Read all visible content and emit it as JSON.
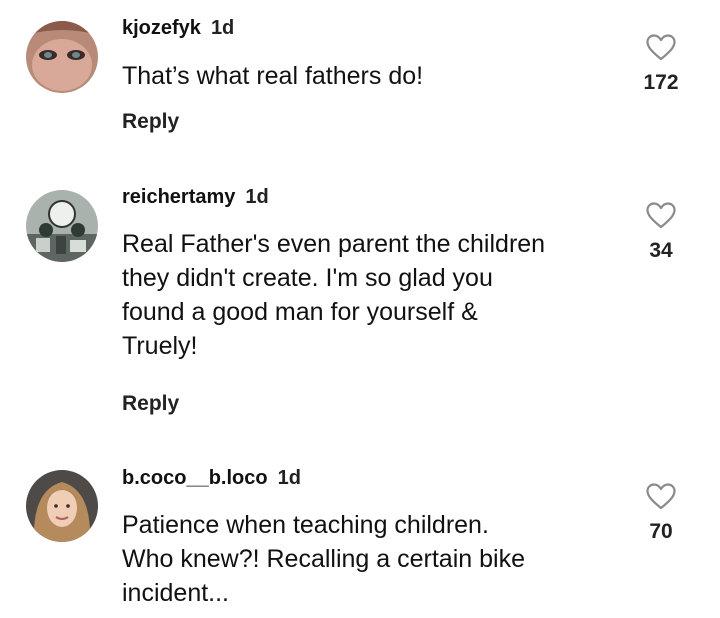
{
  "comments": [
    {
      "username": "kjozefyk",
      "time": "1d",
      "text": "That’s what real fathers do!",
      "reply_label": "Reply",
      "likes": "172",
      "avatar_icon": "avatar-photo-face"
    },
    {
      "username": "reichertamy",
      "time": "1d",
      "text": "Real Father's even parent the children\nthey didn't create. I'm so glad you\nfound a good man for yourself &\nTruely!",
      "reply_label": "Reply",
      "likes": "34",
      "avatar_icon": "avatar-photo-room"
    },
    {
      "username": "b.coco__b.loco",
      "time": "1d",
      "text": "Patience when teaching children.\nWho knew?! Recalling a certain bike\nincident...",
      "likes": "70",
      "avatar_icon": "avatar-photo-woman"
    }
  ],
  "colors": {
    "text": "#111111",
    "heart_outline": "#8a8a8a"
  }
}
